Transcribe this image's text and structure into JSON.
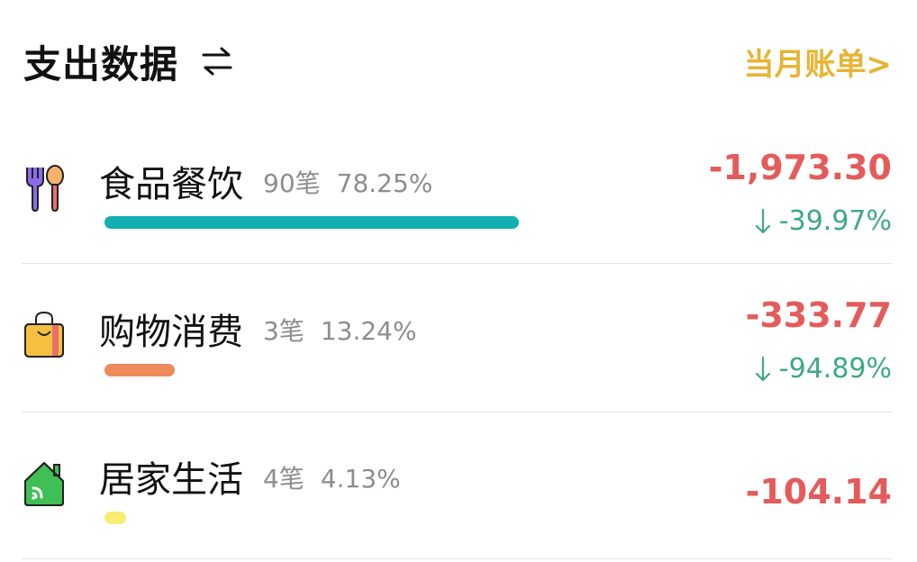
{
  "header": {
    "title": "支出数据",
    "monthly_link": "当月账单>"
  },
  "icons": {
    "swap": "swap-arrows-icon",
    "food": "fork-spoon-icon",
    "shopping": "shopping-bag-icon",
    "home": "house-icon",
    "change_down": "arrow-down-icon"
  },
  "colors": {
    "amount": "#e55b5b",
    "change": "#3eaa7e",
    "monthly_link": "#e8b434"
  },
  "categories": [
    {
      "name": "食品餐饮",
      "count": "90笔",
      "percent": "78.25%",
      "share": 0.7825,
      "amount": "-1,973.30",
      "change": "-39.97%",
      "bar_color": "#12aeb0"
    },
    {
      "name": "购物消费",
      "count": "3笔",
      "percent": "13.24%",
      "share": 0.1324,
      "amount": "-333.77",
      "change": "-94.89%",
      "bar_color": "#ec8a5a"
    },
    {
      "name": "居家生活",
      "count": "4笔",
      "percent": "4.13%",
      "share": 0.0413,
      "amount": "-104.14",
      "change": "",
      "bar_color": "#f6ee72"
    }
  ]
}
